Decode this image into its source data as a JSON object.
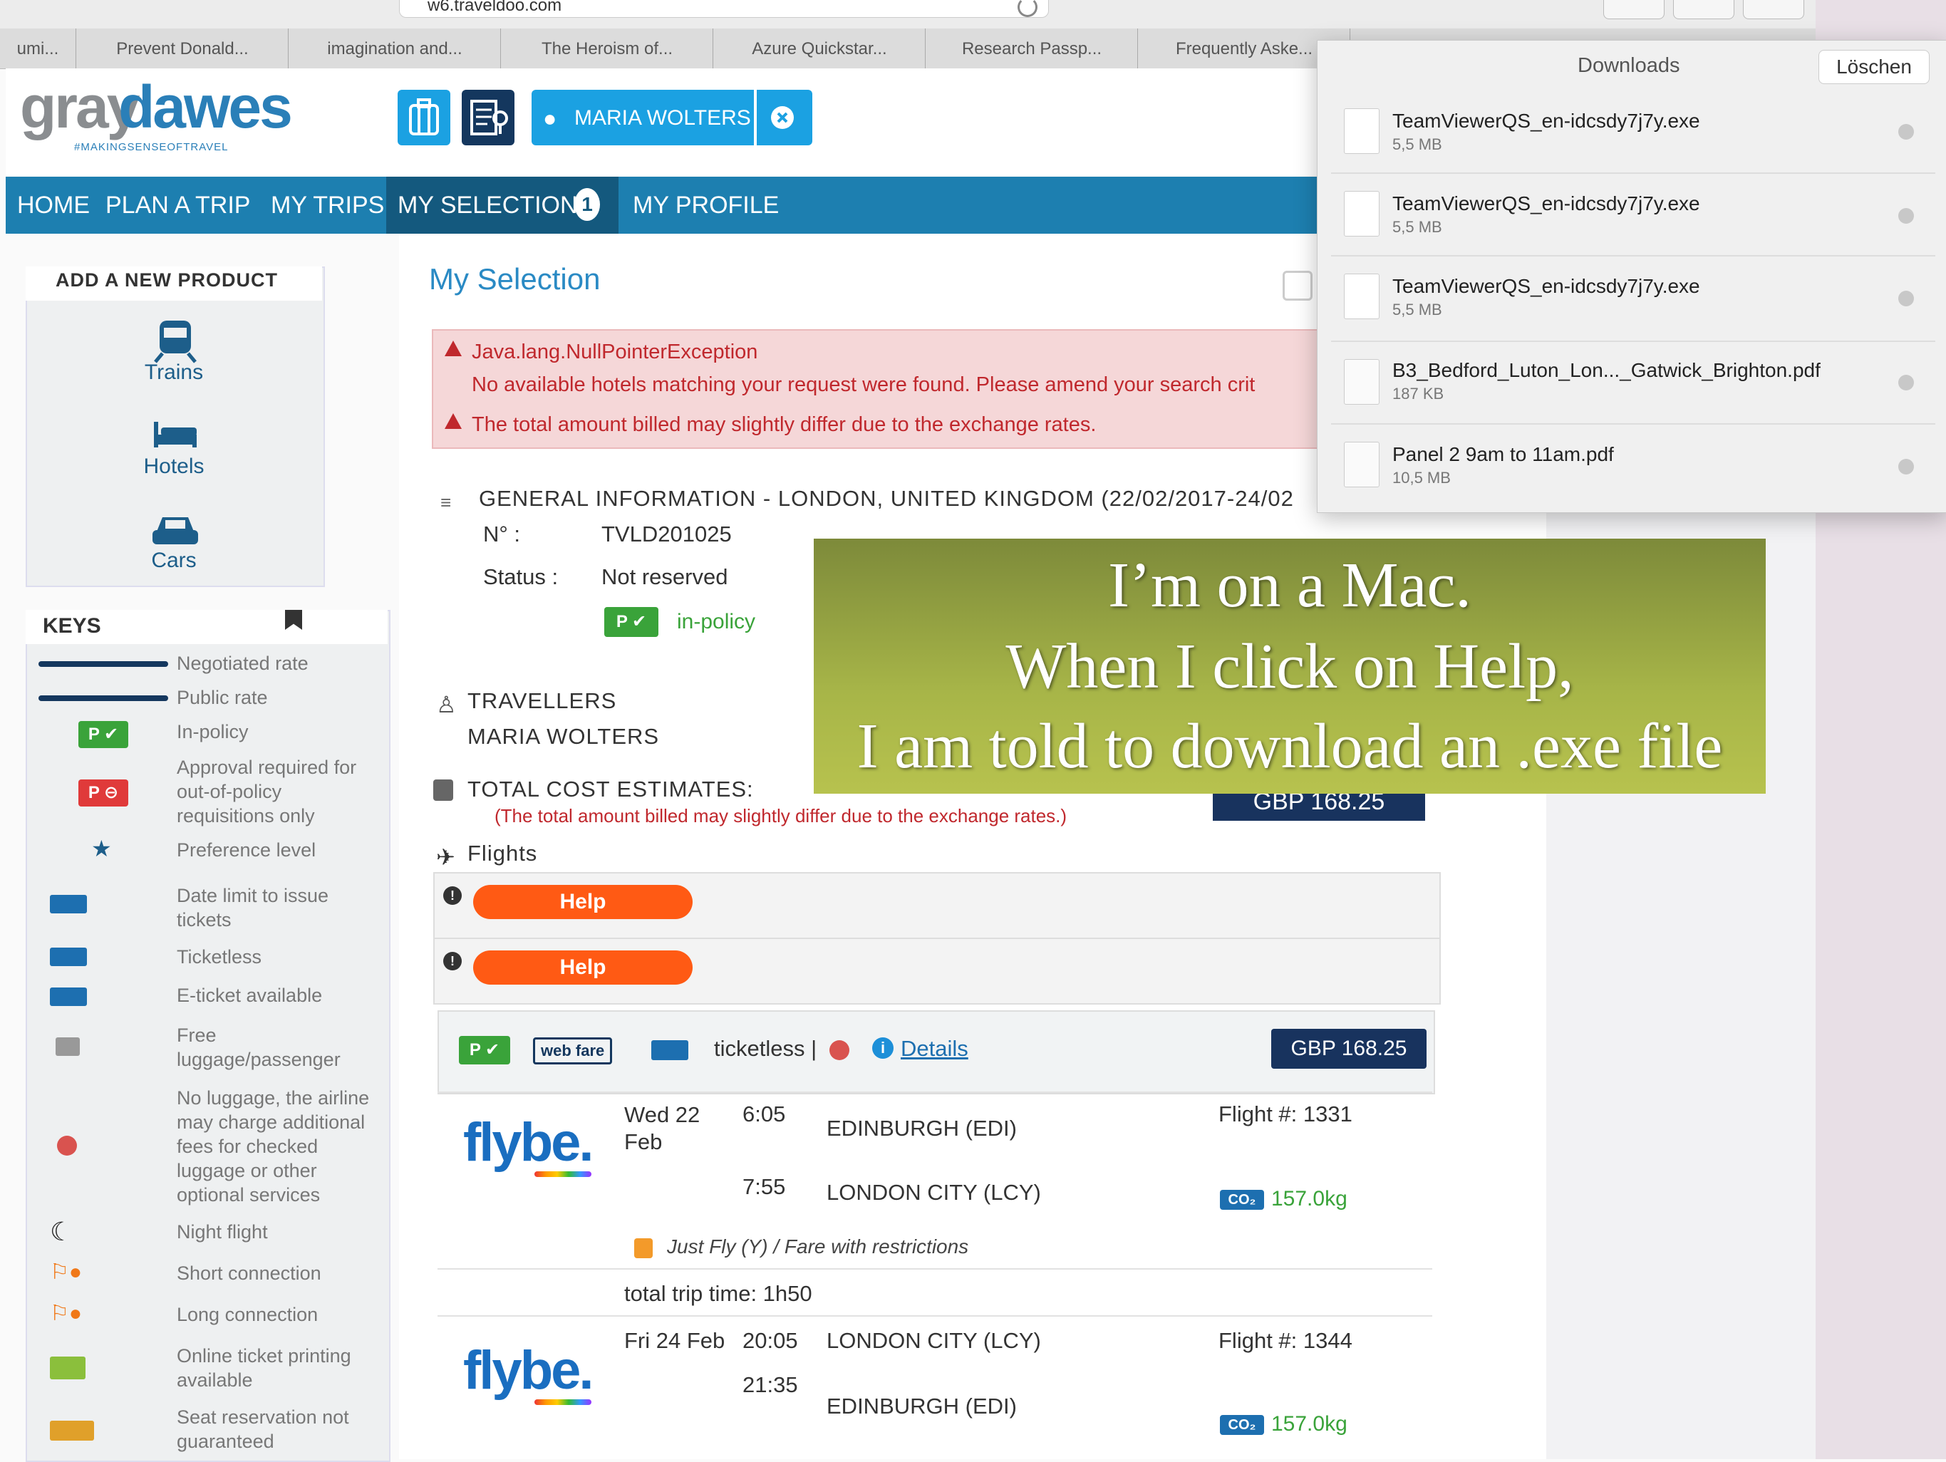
{
  "browser": {
    "url": "w6.traveldoo.com",
    "tabs": [
      "umi...",
      "Prevent Donald...",
      "imagination and...",
      "The Heroism of...",
      "Azure Quickstar...",
      "Research Passp...",
      "Frequently Aske..."
    ]
  },
  "header": {
    "logo_part1": "gray",
    "logo_part2": "dawes",
    "tagline": "#MAKINGSENSEOFTRAVEL",
    "user_name": "MARIA WOLTERS"
  },
  "nav": {
    "items": [
      "HOME",
      "PLAN A TRIP",
      "MY TRIPS",
      "MY SELECTION",
      "MY PROFILE"
    ],
    "selection_count": "1"
  },
  "add_product": {
    "title": "ADD A NEW PRODUCT",
    "items": [
      "Trains",
      "Hotels",
      "Cars"
    ]
  },
  "keys": {
    "title": "KEYS",
    "items": [
      "Negotiated rate",
      "Public rate",
      "In-policy",
      "Approval required for out-of-policy requisitions only",
      "Preference level",
      "Date limit to issue tickets",
      "Ticketless",
      "E-ticket available",
      "Free luggage/passenger",
      "No luggage, the airline may charge additional fees for checked luggage or other optional services",
      "Night flight",
      "Short connection",
      "Long connection",
      "Online ticket printing available",
      "Seat reservation not guaranteed"
    ]
  },
  "main": {
    "title": "My Selection",
    "alerts": [
      "Java.lang.NullPointerException",
      "No available hotels matching your request were found. Please amend your search crit",
      "The total amount billed may slightly differ due to the exchange rates."
    ],
    "general_info": {
      "heading": "GENERAL INFORMATION - LONDON, UNITED KINGDOM (22/02/2017-24/02",
      "number_label": "N° :",
      "number_value": "TVLD201025",
      "status_label": "Status :",
      "status_value": "Not reserved",
      "policy_badge": "P ✔",
      "policy_text": "in-policy"
    },
    "travellers": {
      "heading": "TRAVELLERS",
      "name": "MARIA WOLTERS"
    },
    "cost": {
      "heading": "TOTAL COST ESTIMATES:",
      "note": "(The total amount billed may slightly differ due to the exchange rates.)",
      "value": "GBP 168.25"
    },
    "flights_heading": "Flights",
    "help_label": "Help",
    "fare": {
      "web_fare": "web fare",
      "ticketless": "ticketless |",
      "details": "Details",
      "price": "GBP 168.25",
      "policy_badge": "P ✔"
    },
    "outbound": {
      "airline": "flybe.",
      "date": "Wed 22 Feb",
      "dep_time": "6:05",
      "dep_airport": "EDINBURGH (EDI)",
      "arr_time": "7:55",
      "arr_airport": "LONDON CITY (LCY)",
      "flight_no": "Flight #: 1331",
      "co2": "157.0kg",
      "fare_type": "Just Fly (Y) / Fare with restrictions",
      "total_time": "total trip time: 1h50"
    },
    "inbound": {
      "airline": "flybe.",
      "date": "Fri 24 Feb",
      "dep_time": "20:05",
      "dep_airport": "LONDON CITY (LCY)",
      "arr_time": "21:35",
      "arr_airport": "EDINBURGH (EDI)",
      "flight_no": "Flight #: 1344",
      "co2": "157.0kg"
    },
    "co2_label": "CO₂"
  },
  "downloads": {
    "title": "Downloads",
    "clear_label": "Löschen",
    "items": [
      {
        "name": "TeamViewerQS_en-idcsdy7j7y.exe",
        "size": "5,5 MB"
      },
      {
        "name": "TeamViewerQS_en-idcsdy7j7y.exe",
        "size": "5,5 MB"
      },
      {
        "name": "TeamViewerQS_en-idcsdy7j7y.exe",
        "size": "5,5 MB"
      },
      {
        "name": "B3_Bedford_Luton_Lon..._Gatwick_Brighton.pdf",
        "size": "187 KB"
      },
      {
        "name": "Panel 2 9am to 11am.pdf",
        "size": "10,5 MB"
      }
    ]
  },
  "caption": {
    "line1": "I’m on a Mac.",
    "line2": "When I click on Help,",
    "line3": "I am told to download an .exe file"
  }
}
